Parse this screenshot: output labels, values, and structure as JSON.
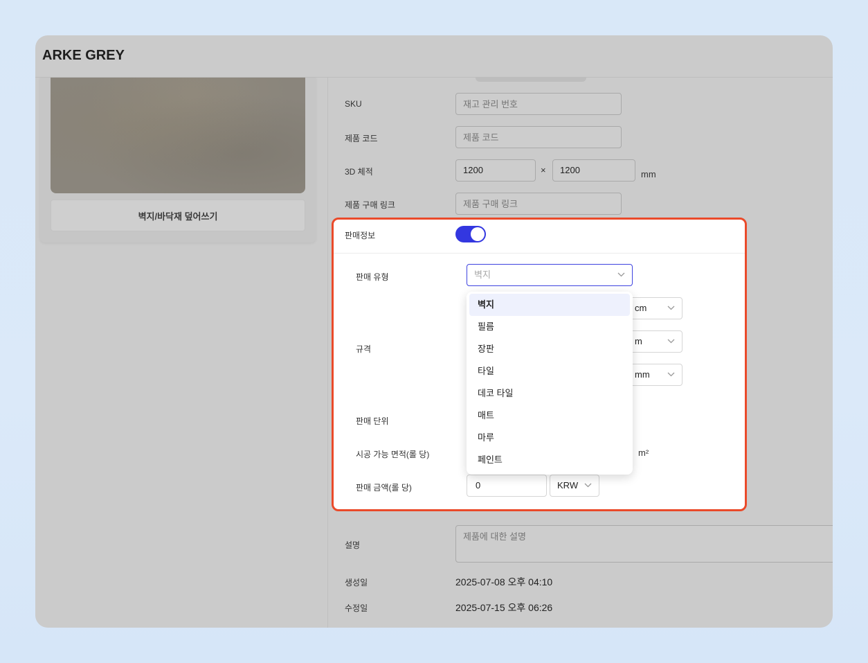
{
  "window": {
    "title": "ARKE GREY"
  },
  "left": {
    "overwrite_button": "벽지/바닥재 덮어쓰기"
  },
  "form": {
    "sku": {
      "label": "SKU",
      "placeholder": "재고 관리 번호"
    },
    "product_code": {
      "label": "제품 코드",
      "placeholder": "제품 코드"
    },
    "dimensions": {
      "label": "3D 체적",
      "width": "1200",
      "height": "1200",
      "times": "×",
      "unit": "mm"
    },
    "purchase_link": {
      "label": "제품 구매 링크",
      "placeholder": "제품 구매 링크"
    },
    "description": {
      "label": "설명",
      "placeholder": "제품에 대한 설명"
    },
    "created": {
      "label": "생성일",
      "value": "2025-07-08 오후 04:10"
    },
    "modified": {
      "label": "수정일",
      "value": "2025-07-15 오후 06:26"
    }
  },
  "sales": {
    "label": "판매정보",
    "toggle_on": true,
    "sale_type": {
      "label": "판매 유형",
      "placeholder": "벽지"
    },
    "spec": {
      "label": "규격",
      "units": [
        "cm",
        "m",
        "mm"
      ]
    },
    "sale_unit": {
      "label": "판매 단위"
    },
    "area": {
      "label": "시공 가능 면적(롤 당)",
      "unit": "m²"
    },
    "price": {
      "label": "판매 금액(롤 당)",
      "value": "0",
      "currency": "KRW"
    },
    "dropdown_options": [
      "벽지",
      "필름",
      "장판",
      "타일",
      "데코 타일",
      "매트",
      "마루",
      "페인트"
    ],
    "selected_option": "벽지"
  },
  "colors": {
    "toggle": "#3337e0",
    "highlight_border": "#ea4a2a"
  }
}
